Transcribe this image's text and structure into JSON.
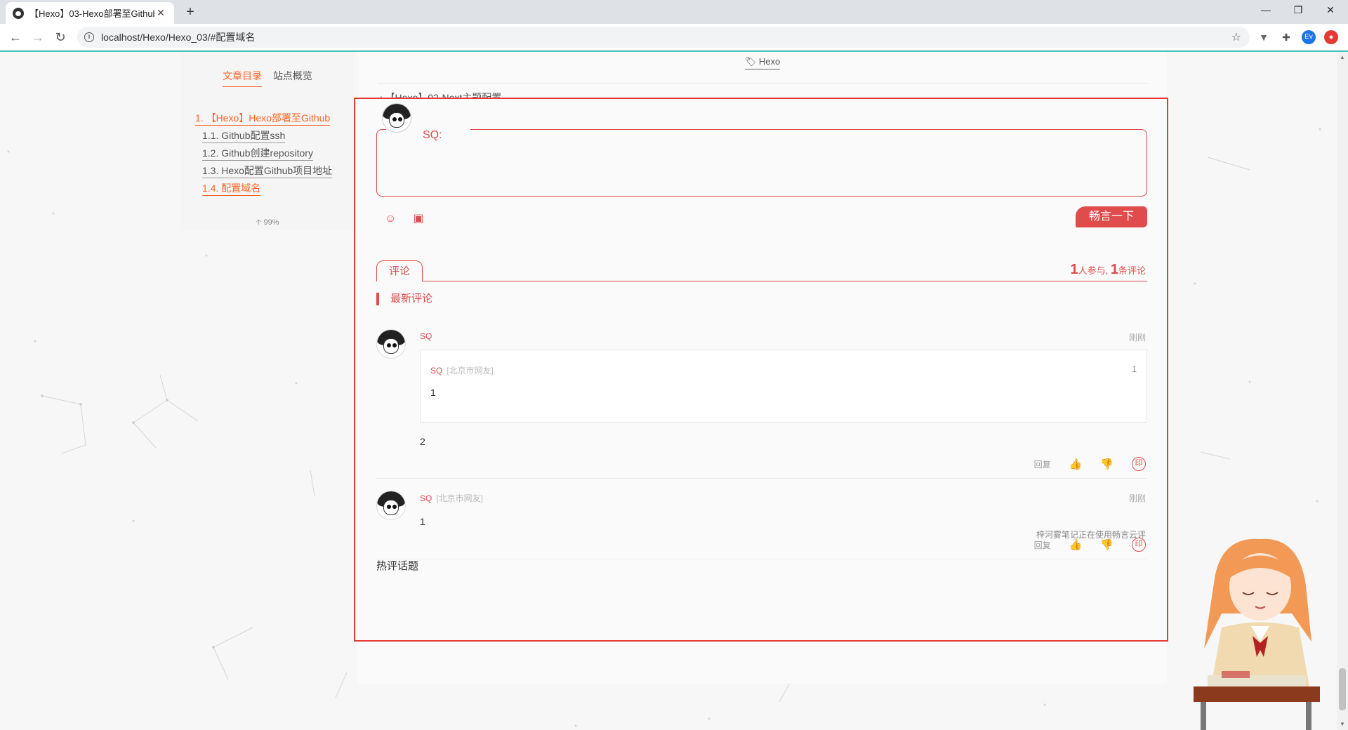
{
  "browser": {
    "tab_title": "【Hexo】03-Hexo部署至Github",
    "new_tab": "+",
    "url": "localhost/Hexo/Hexo_03/#配置域名",
    "ext_ev": "Ev"
  },
  "sidebar": {
    "tab_toc": "文章目录",
    "tab_overview": "站点概览",
    "toc": [
      "1. 【Hexo】Hexo部署至Github",
      "1.1. Github配置ssh",
      "1.2. Github创建repository",
      "1.3. Hexo配置Github项目地址",
      "1.4. 配置域名"
    ],
    "progress": "99%"
  },
  "post": {
    "tag": "Hexo",
    "prev_post": "【Hexo】02-Next主题配置"
  },
  "comment_box": {
    "user_label": "SQ:",
    "submit_label": "畅言一下",
    "tab_label": "评论",
    "participants": "1",
    "participants_suffix": "人参与,",
    "comment_count": "1",
    "comment_suffix": "条评论",
    "latest_label": "最新评论",
    "powered_by": "梓河雾笔记正在使用畅言云评",
    "hot_topics": "热评话题",
    "accent": "#e04b4b"
  },
  "comments": [
    {
      "name": "SQ",
      "time": "刚刚",
      "quote": {
        "name": "SQ",
        "location": "[北京市网友]",
        "num": "1",
        "body": "1"
      },
      "body": "2",
      "reply": "回复"
    },
    {
      "name": "SQ",
      "location": "[北京市网友]",
      "time": "刚刚",
      "body": "1",
      "reply": "回复"
    }
  ]
}
